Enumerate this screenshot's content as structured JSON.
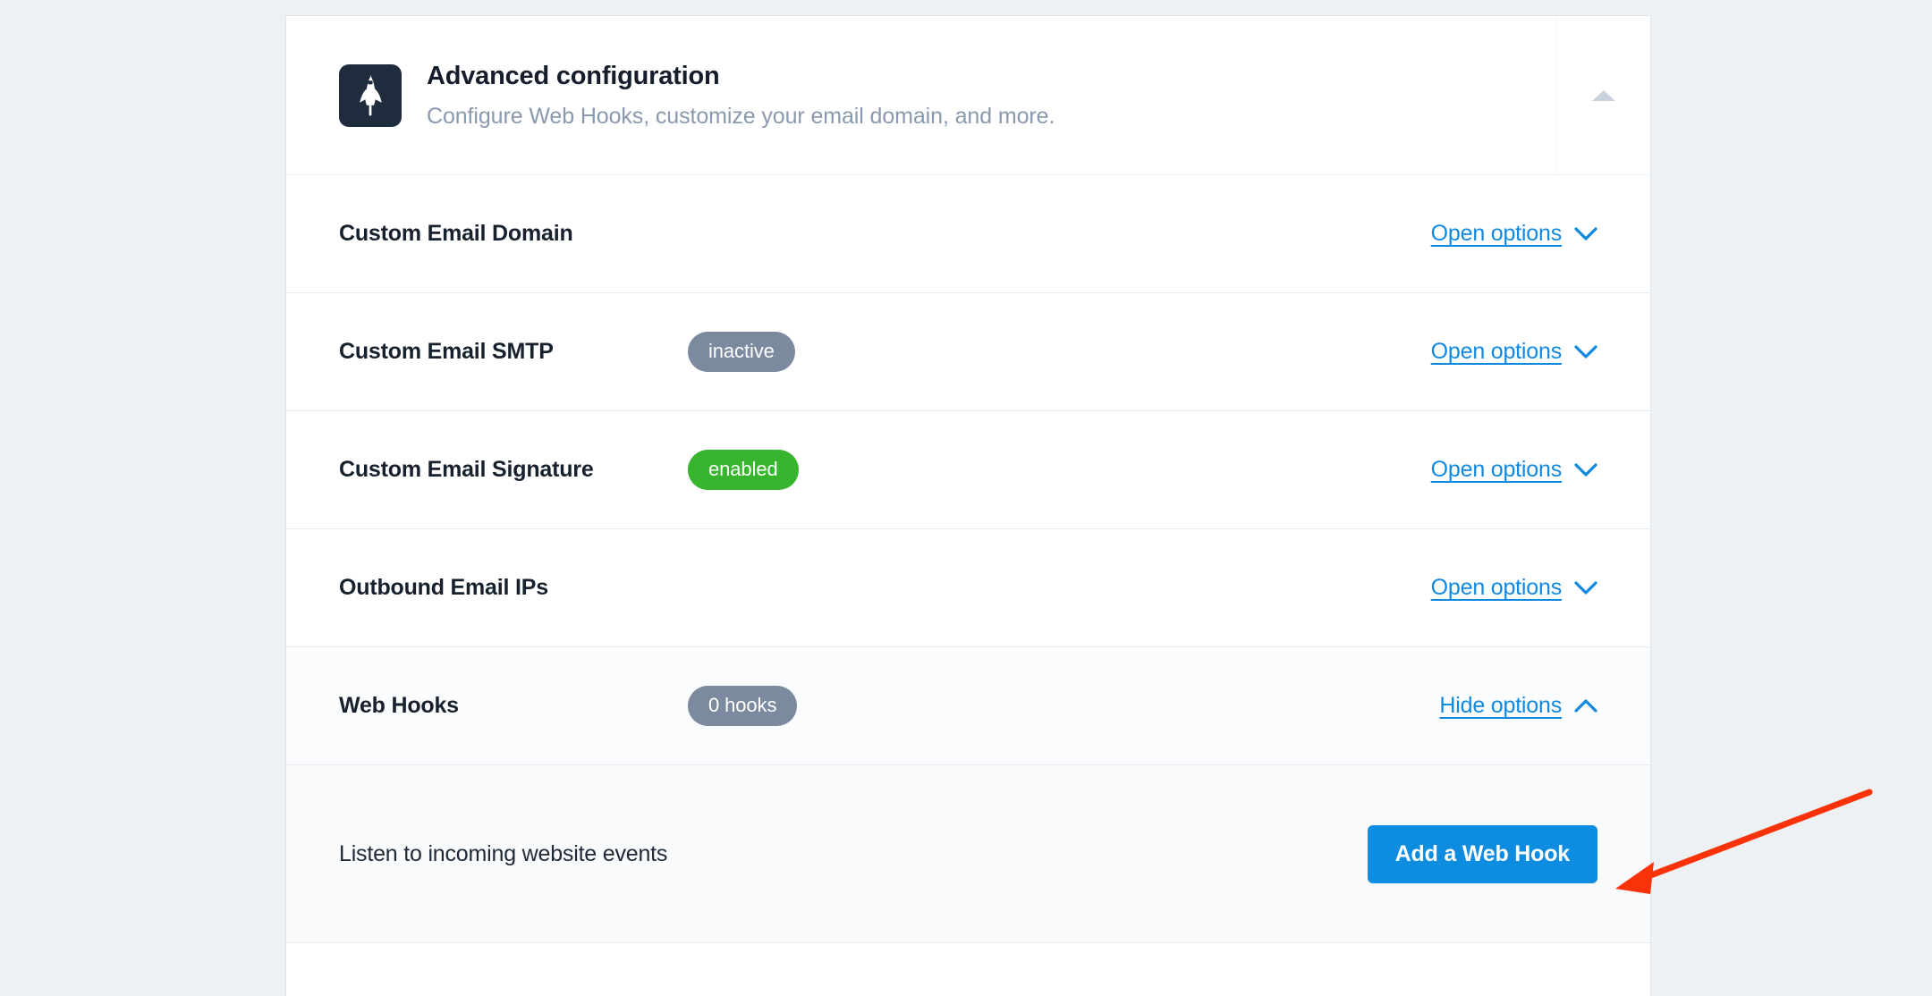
{
  "card": {
    "header": {
      "icon": "rocket-shuttle-icon",
      "title": "Advanced configuration",
      "subtitle": "Configure Web Hooks, customize your email domain, and more.",
      "collapse_icon": "triangle-up-icon"
    },
    "rows": [
      {
        "label": "Custom Email Domain",
        "badge": null,
        "badge_style": null,
        "action_label": "Open options",
        "action_icon": "chevron-down-icon",
        "expanded": false
      },
      {
        "label": "Custom Email SMTP",
        "badge": "inactive",
        "badge_style": "gray",
        "action_label": "Open options",
        "action_icon": "chevron-down-icon",
        "expanded": false
      },
      {
        "label": "Custom Email Signature",
        "badge": "enabled",
        "badge_style": "green",
        "action_label": "Open options",
        "action_icon": "chevron-down-icon",
        "expanded": false
      },
      {
        "label": "Outbound Email IPs",
        "badge": null,
        "badge_style": null,
        "action_label": "Open options",
        "action_icon": "chevron-down-icon",
        "expanded": false
      },
      {
        "label": "Web Hooks",
        "badge": "0 hooks",
        "badge_style": "gray",
        "action_label": "Hide options",
        "action_icon": "chevron-up-icon",
        "expanded": true
      }
    ],
    "webhooks_panel": {
      "description": "Listen to incoming website events",
      "button_label": "Add a Web Hook"
    }
  },
  "colors": {
    "accent_link": "#1089e0",
    "button_primary": "#0d8ce0",
    "badge_gray": "#7b8a9e",
    "badge_green": "#38b52e",
    "icon_tile": "#1f2c3d",
    "annotation_arrow": "#fa3208",
    "page_background": "#eef1f4"
  },
  "annotation": {
    "arrow": "red-arrow-pointing-to-add-a-web-hook-button"
  }
}
